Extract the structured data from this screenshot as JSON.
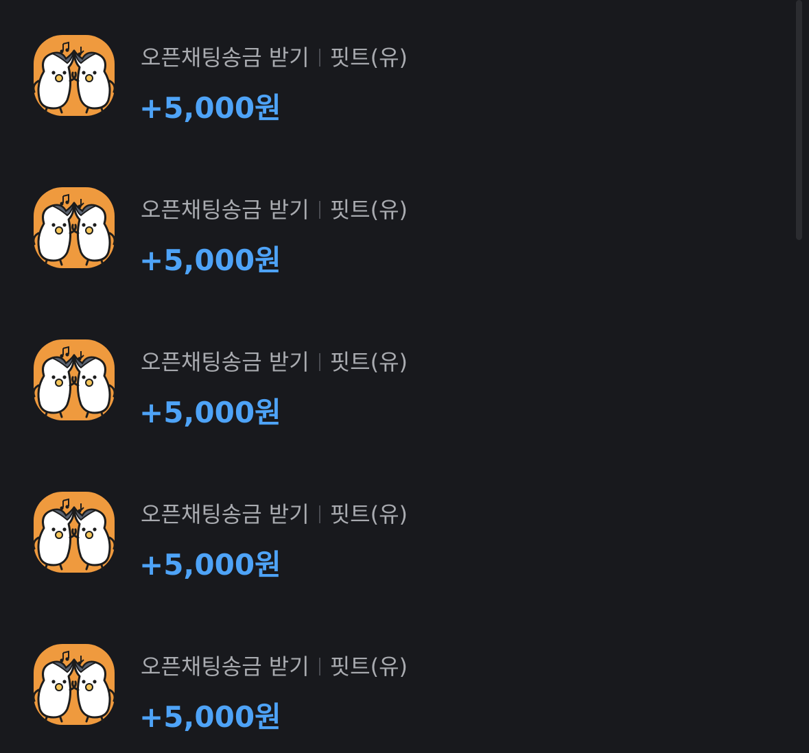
{
  "transactions": [
    {
      "title": "오픈채팅송금 받기",
      "counterparty": "핏트(유)",
      "amount": "+5,000원",
      "icon": "dancing-penguins-icon"
    },
    {
      "title": "오픈채팅송금 받기",
      "counterparty": "핏트(유)",
      "amount": "+5,000원",
      "icon": "dancing-penguins-icon"
    },
    {
      "title": "오픈채팅송금 받기",
      "counterparty": "핏트(유)",
      "amount": "+5,000원",
      "icon": "dancing-penguins-icon"
    },
    {
      "title": "오픈채팅송금 받기",
      "counterparty": "핏트(유)",
      "amount": "+5,000원",
      "icon": "dancing-penguins-icon"
    },
    {
      "title": "오픈채팅송금 받기",
      "counterparty": "핏트(유)",
      "amount": "+5,000원",
      "icon": "dancing-penguins-icon"
    }
  ],
  "colors": {
    "background": "#18191d",
    "title_text": "#a9abb0",
    "amount_text": "#4ea3f7",
    "icon_bg": "#ef9a3e"
  }
}
